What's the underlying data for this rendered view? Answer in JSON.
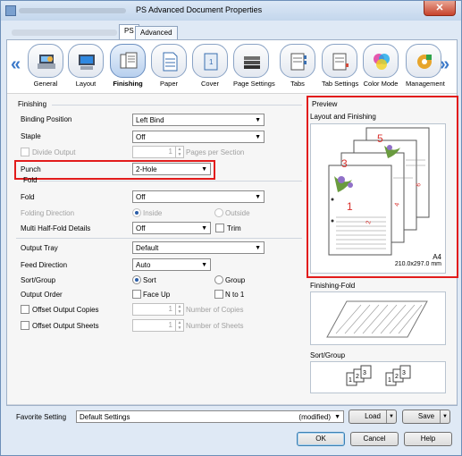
{
  "window": {
    "title": "PS Advanced Document Properties",
    "close": "✕"
  },
  "tabs": [
    {
      "label": "PS"
    },
    {
      "label": "Advanced"
    }
  ],
  "functions": [
    {
      "label": "General"
    },
    {
      "label": "Layout"
    },
    {
      "label": "Finishing"
    },
    {
      "label": "Paper"
    },
    {
      "label": "Cover"
    },
    {
      "label": "Page Settings"
    },
    {
      "label": "Tabs"
    },
    {
      "label": "Tab Settings"
    },
    {
      "label": "Color Mode"
    },
    {
      "label": "Management"
    }
  ],
  "finishing": {
    "section": "Finishing",
    "binding_label": "Binding Position",
    "binding_value": "Left Bind",
    "staple_label": "Staple",
    "staple_value": "Off",
    "divide_output_label": "Divide Output",
    "divide_count": "1",
    "pages_per_section": "Pages per Section",
    "punch_label": "Punch",
    "punch_value": "2-Hole",
    "fold_group": "Fold",
    "fold_label": "Fold",
    "fold_value": "Off",
    "folding_direction_label": "Folding Direction",
    "inside": "Inside",
    "outside": "Outside",
    "multi_half_fold_label": "Multi Half-Fold Details",
    "multi_half_fold_value": "Off",
    "trim": "Trim",
    "output_tray_label": "Output Tray",
    "output_tray_value": "Default",
    "feed_direction_label": "Feed Direction",
    "feed_direction_value": "Auto",
    "sort_group_label": "Sort/Group",
    "sort": "Sort",
    "group": "Group",
    "output_order_label": "Output Order",
    "face_up": "Face Up",
    "n_to_1": "N to 1",
    "offset_copies_label": "Offset Output Copies",
    "offset_copies_value": "1",
    "number_of_copies": "Number of Copies",
    "offset_sheets_label": "Offset Output Sheets",
    "offset_sheets_value": "1",
    "number_of_sheets": "Number of Sheets"
  },
  "preview": {
    "section": "Preview",
    "layout_label": "Layout and Finishing",
    "page_numbers": [
      "1",
      "2",
      "3",
      "4",
      "5",
      "6"
    ],
    "paper_size": "A4",
    "paper_dims": "210.0x297.0 mm",
    "finishing_fold_label": "Finishing-Fold",
    "sort_group_label": "Sort/Group",
    "sort_icon_numbers": [
      "1",
      "2",
      "3"
    ]
  },
  "footer": {
    "favorite_label": "Favorite Setting",
    "favorite_value": "Default Settings",
    "modified": "(modified)",
    "load": "Load",
    "save": "Save",
    "ok": "OK",
    "cancel": "Cancel",
    "help": "Help"
  },
  "colors": {
    "highlight": "#e21c1c",
    "accent": "#3a78c9",
    "window_bg": "#dfe9f5"
  }
}
